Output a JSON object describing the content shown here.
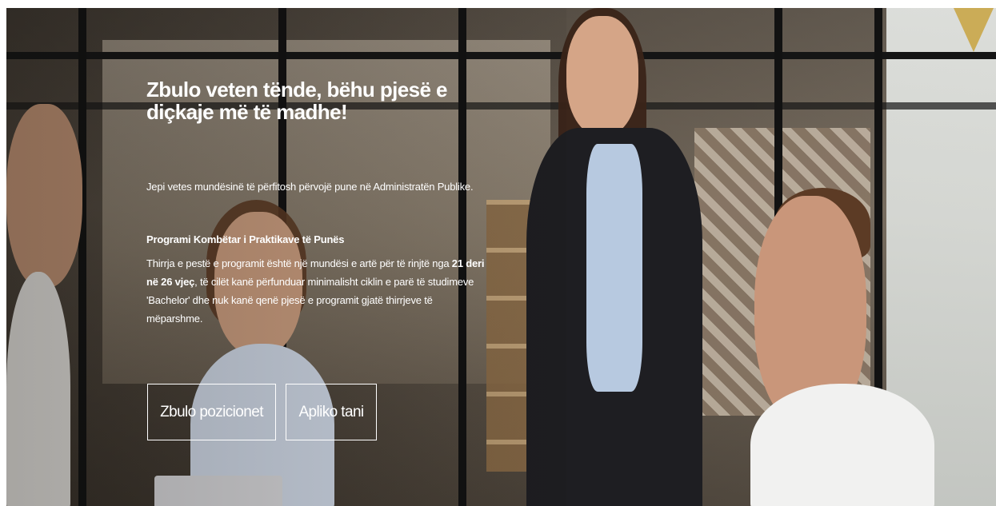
{
  "hero": {
    "headline": "Zbulo veten tënde, bëhu pjesë e diçkaje më të madhe!",
    "lead": "Jepi vetes mundësinë të përfitosh përvojë pune në Administratën Publike.",
    "program_title": "Programi Kombëtar i Praktikave të Punës",
    "program_desc": {
      "part1": "Thirrja e pestë e programit është një mundësi e artë për të rinjtë nga ",
      "age_range": "21 deri në 26 vjeç",
      "part2": ", të cilët kanë përfunduar minimalisht ciklin e parë të studimeve 'Bachelor' dhe nuk kanë qenë pjesë e programit gjatë thirrjeve të mëparshme."
    },
    "buttons": {
      "discover_positions": "Zbulo pozicionet",
      "apply_now": "Apliko tani"
    }
  }
}
